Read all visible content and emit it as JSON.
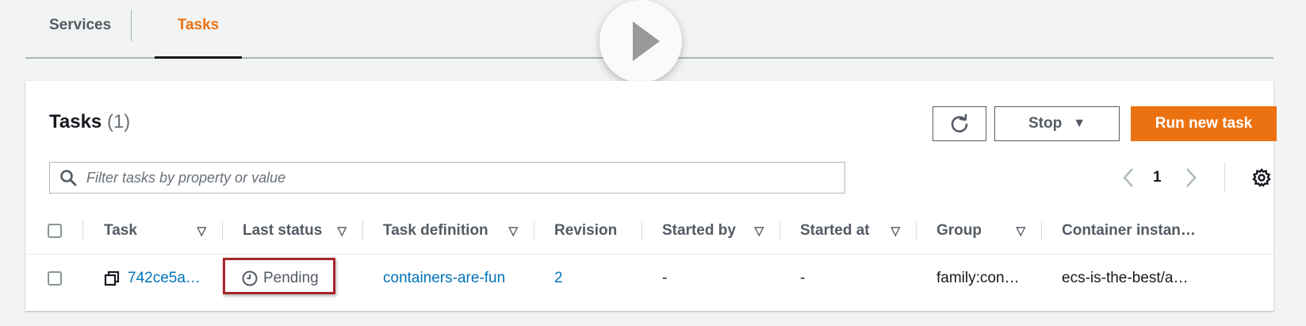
{
  "tabs": [
    {
      "label": "Services"
    },
    {
      "label": "Tasks"
    }
  ],
  "panel": {
    "title": "Tasks",
    "count": "(1)"
  },
  "toolbar": {
    "stop_label": "Stop",
    "run_label": "Run new task"
  },
  "search": {
    "placeholder": "Filter tasks by property or value"
  },
  "pagination": {
    "current_page": "1"
  },
  "table": {
    "columns": [
      "Task",
      "Last status",
      "Task definition",
      "Revision",
      "Started by",
      "Started at",
      "Group",
      "Container instan…"
    ],
    "rows": [
      {
        "task": "742ce5a…",
        "last_status": "Pending",
        "task_definition": "containers-are-fun",
        "revision": "2",
        "started_by": "-",
        "started_at": "-",
        "group": "family:con…",
        "container_instance": "ecs-is-the-best/a…"
      }
    ]
  },
  "colors": {
    "accent": "#ec7211",
    "link": "#0073bb",
    "highlight_border": "#a9262a"
  },
  "icons": [
    "play-icon",
    "refresh-icon",
    "caret-down-icon",
    "search-icon",
    "chevron-left-icon",
    "chevron-right-icon",
    "gear-icon",
    "sort-icon",
    "copy-icon",
    "clock-icon"
  ]
}
